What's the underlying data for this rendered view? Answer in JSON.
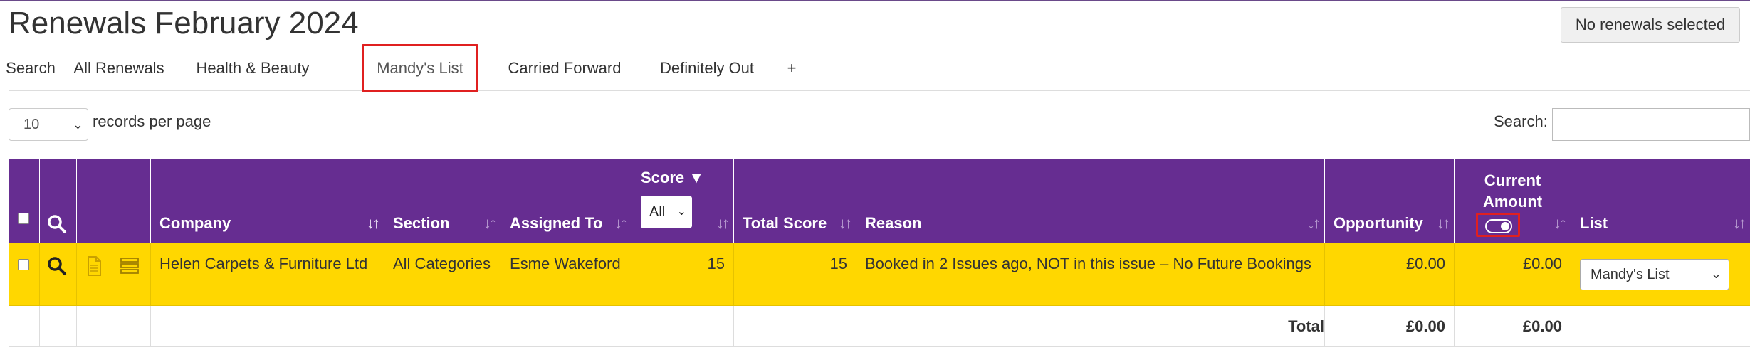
{
  "page": {
    "title": "Renewals February 2024",
    "selection_status": "No renewals selected"
  },
  "tabs": [
    "Search",
    "All Renewals",
    "Health & Beauty",
    "Mandy's List",
    "Carried Forward",
    "Definitely Out",
    "+"
  ],
  "active_tab": "Mandy's List",
  "controls": {
    "per_page_value": "10",
    "per_page_label": "records per page",
    "search_label": "Search:",
    "search_value": ""
  },
  "table": {
    "headers": {
      "company": "Company",
      "section": "Section",
      "assigned_to": "Assigned To",
      "score": "Score",
      "score_filter": "All",
      "total_score": "Total Score",
      "reason": "Reason",
      "opportunity": "Opportunity",
      "current_amount": "Current Amount",
      "list": "List"
    },
    "rows": [
      {
        "company": "Helen Carpets & Furniture Ltd",
        "section": "All Categories",
        "assigned_to": "Esme Wakeford",
        "score": "15",
        "total_score": "15",
        "reason": "Booked in 2 Issues ago, NOT in this issue – No Future Bookings",
        "opportunity": "£0.00",
        "current_amount": "£0.00",
        "list": "Mandy's List"
      }
    ],
    "totals": {
      "label": "Total",
      "opportunity": "£0.00",
      "current_amount": "£0.00"
    }
  },
  "colors": {
    "header_bg": "#662d91",
    "row_highlight": "#ffd700",
    "annotation": "#e02020"
  },
  "icons": {
    "header_search": "search-icon",
    "row_search": "search-icon",
    "row_document": "document-icon",
    "row_list": "list-icon",
    "score_filter": "filter-icon",
    "sort": "sort-icon",
    "toggle": "toggle-icon"
  }
}
